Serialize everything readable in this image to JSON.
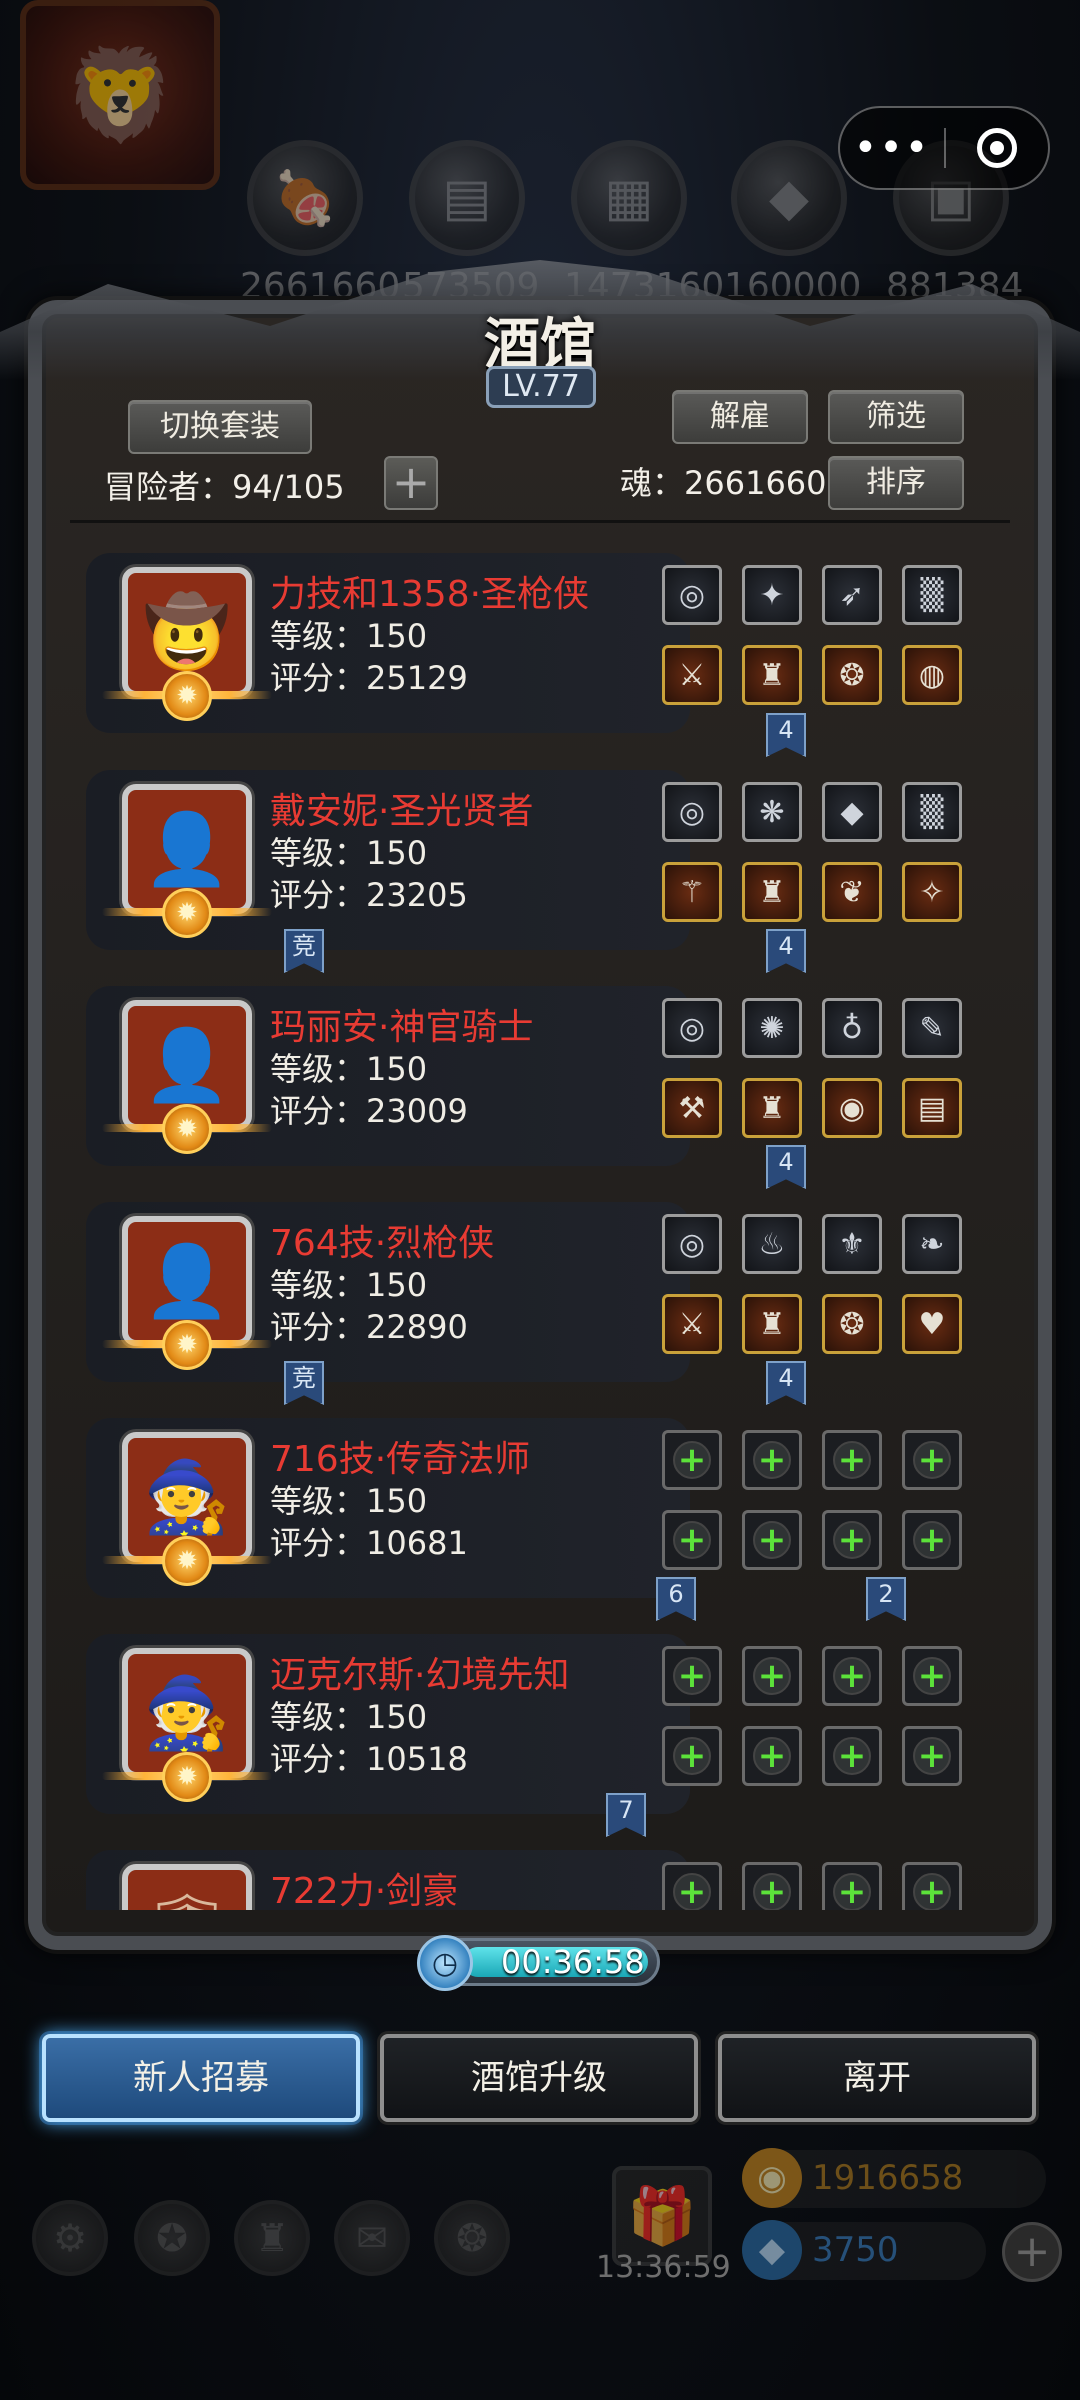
{
  "capsule": {
    "more_icon": "•••",
    "target_icon": "◎"
  },
  "resources": [
    {
      "icon": "meat-icon",
      "glyph": "🍖",
      "value": "2661660"
    },
    {
      "icon": "wood-icon",
      "glyph": "▤",
      "value": "573509"
    },
    {
      "icon": "stone-icon",
      "glyph": "▦",
      "value": "1473160"
    },
    {
      "icon": "crystal-icon",
      "glyph": "◆",
      "value": "160000"
    },
    {
      "icon": "iron-icon",
      "glyph": "▣",
      "value": "881384"
    }
  ],
  "tavern": {
    "title": "酒馆",
    "level": "LV.77",
    "switch_outfit_label": "切换套装",
    "dismiss_label": "解雇",
    "filter_label": "筛选",
    "sort_label": "排序",
    "adventurers": "冒险者：94/105",
    "soul": "魂：2661660"
  },
  "heroes": [
    {
      "name": "力技和1358·圣枪侠",
      "level": "等级：150",
      "score": "评分：25129",
      "glyph": "🤠",
      "equip": [
        {
          "kind": "grey",
          "glyph": "◎"
        },
        {
          "kind": "grey",
          "glyph": "✦"
        },
        {
          "kind": "grey",
          "glyph": "➶"
        },
        {
          "kind": "grey",
          "glyph": "▒"
        },
        {
          "kind": "gold",
          "glyph": "⚔"
        },
        {
          "kind": "gold",
          "glyph": "♜"
        },
        {
          "kind": "gold",
          "glyph": "❂"
        },
        {
          "kind": "gold",
          "glyph": "◍"
        }
      ]
    },
    {
      "name": "戴安妮·圣光贤者",
      "level": "等级：150",
      "score": "评分：23205",
      "glyph": "👤",
      "equip": [
        {
          "kind": "grey",
          "glyph": "◎"
        },
        {
          "kind": "grey",
          "glyph": "❋"
        },
        {
          "kind": "grey",
          "glyph": "◆"
        },
        {
          "kind": "grey",
          "glyph": "▒"
        },
        {
          "kind": "gold",
          "glyph": "⚚"
        },
        {
          "kind": "gold",
          "glyph": "♜"
        },
        {
          "kind": "gold",
          "glyph": "❦"
        },
        {
          "kind": "gold",
          "glyph": "✧"
        }
      ]
    },
    {
      "name": "玛丽安·神官骑士",
      "level": "等级：150",
      "score": "评分：23009",
      "glyph": "👤",
      "equip": [
        {
          "kind": "grey",
          "glyph": "◎"
        },
        {
          "kind": "grey",
          "glyph": "✺"
        },
        {
          "kind": "grey",
          "glyph": "♁"
        },
        {
          "kind": "grey",
          "glyph": "✎"
        },
        {
          "kind": "gold",
          "glyph": "⚒"
        },
        {
          "kind": "gold",
          "glyph": "♜"
        },
        {
          "kind": "gold",
          "glyph": "◉"
        },
        {
          "kind": "gold",
          "glyph": "▤"
        }
      ]
    },
    {
      "name": "764技·烈枪侠",
      "level": "等级：150",
      "score": "评分：22890",
      "glyph": "👤",
      "equip": [
        {
          "kind": "grey",
          "glyph": "◎"
        },
        {
          "kind": "grey",
          "glyph": "♨"
        },
        {
          "kind": "grey",
          "glyph": "⚜"
        },
        {
          "kind": "grey",
          "glyph": "❧"
        },
        {
          "kind": "gold",
          "glyph": "⚔"
        },
        {
          "kind": "gold",
          "glyph": "♜"
        },
        {
          "kind": "gold",
          "glyph": "❂"
        },
        {
          "kind": "gold",
          "glyph": "♥"
        }
      ]
    },
    {
      "name": "716技·传奇法师",
      "level": "等级：150",
      "score": "评分：10681",
      "glyph": "🧙",
      "equip": [
        {
          "kind": "empty",
          "glyph": "+"
        },
        {
          "kind": "empty",
          "glyph": "+"
        },
        {
          "kind": "empty",
          "glyph": "+"
        },
        {
          "kind": "empty",
          "glyph": "+"
        },
        {
          "kind": "empty",
          "glyph": "+"
        },
        {
          "kind": "empty",
          "glyph": "+"
        },
        {
          "kind": "empty",
          "glyph": "+"
        },
        {
          "kind": "empty",
          "glyph": "+"
        }
      ]
    },
    {
      "name": "迈克尔斯·幻境先知",
      "level": "等级：150",
      "score": "评分：10518",
      "glyph": "🧙",
      "equip": [
        {
          "kind": "empty",
          "glyph": "+"
        },
        {
          "kind": "empty",
          "glyph": "+"
        },
        {
          "kind": "empty",
          "glyph": "+"
        },
        {
          "kind": "empty",
          "glyph": "+"
        },
        {
          "kind": "empty",
          "glyph": "+"
        },
        {
          "kind": "empty",
          "glyph": "+"
        },
        {
          "kind": "empty",
          "glyph": "+"
        },
        {
          "kind": "empty",
          "glyph": "+"
        }
      ]
    },
    {
      "name": "722力·剑豪",
      "level": "",
      "score": "",
      "glyph": "🛡",
      "equip": [
        {
          "kind": "empty",
          "glyph": "+"
        },
        {
          "kind": "empty",
          "glyph": "+"
        },
        {
          "kind": "empty",
          "glyph": "+"
        },
        {
          "kind": "empty",
          "glyph": "+"
        }
      ]
    }
  ],
  "badges": {
    "four": "4",
    "compete": "竞",
    "six": "6",
    "two": "2",
    "seven": "7"
  },
  "timer": {
    "clock_glyph": "◷",
    "value": "00:36:58"
  },
  "actions": {
    "recruit": "新人招募",
    "upgrade": "酒馆升级",
    "leave": "离开"
  },
  "bottom": {
    "gift_time": "13:36:59",
    "gold": "1916658",
    "gem": "3750",
    "plus": "+"
  }
}
